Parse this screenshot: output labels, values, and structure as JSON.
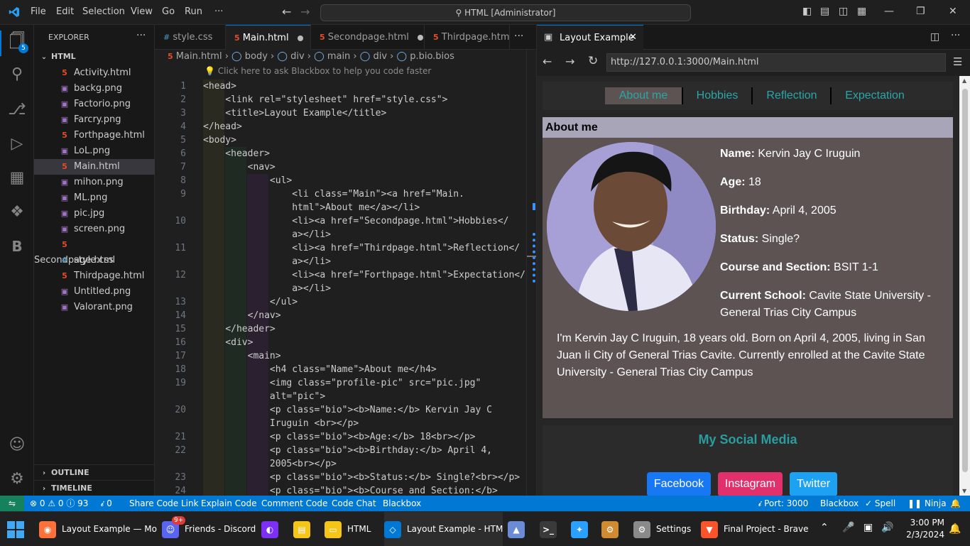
{
  "titlebar": {
    "menus": [
      "File",
      "Edit",
      "Selection",
      "View",
      "Go",
      "Run",
      "···"
    ],
    "command_center": "HTML [Administrator]"
  },
  "activity": {
    "explorer_badge": "5"
  },
  "explorer": {
    "title": "EXPLORER",
    "folder": "HTML",
    "files": [
      {
        "name": "Activity.html",
        "type": "html"
      },
      {
        "name": "backg.png",
        "type": "png"
      },
      {
        "name": "Factorio.png",
        "type": "png"
      },
      {
        "name": "Farcry.png",
        "type": "png"
      },
      {
        "name": "Forthpage.html",
        "type": "html"
      },
      {
        "name": "LoL.png",
        "type": "png"
      },
      {
        "name": "Main.html",
        "type": "html",
        "selected": true
      },
      {
        "name": "mihon.png",
        "type": "png"
      },
      {
        "name": "ML.png",
        "type": "png"
      },
      {
        "name": "pic.jpg",
        "type": "png"
      },
      {
        "name": "screen.png",
        "type": "png"
      },
      {
        "name": "Secondpage.html",
        "type": "html"
      },
      {
        "name": "style.css",
        "type": "css"
      },
      {
        "name": "Thirdpage.html",
        "type": "html"
      },
      {
        "name": "Untitled.png",
        "type": "png"
      },
      {
        "name": "Valorant.png",
        "type": "png"
      }
    ],
    "outline": "OUTLINE",
    "timeline": "TIMELINE"
  },
  "tabs": [
    "style.css",
    "Main.html",
    "Secondpage.html",
    "Thirdpage.htm"
  ],
  "breadcrumb": [
    "Main.html",
    "body",
    "div",
    "main",
    "div",
    "p.bio.bios"
  ],
  "blackbox_hint": "Click here to ask Blackbox to help you code faster",
  "code_lines": [
    {
      "n": "1",
      "t": "<head>"
    },
    {
      "n": "2",
      "t": "    <link rel=\"stylesheet\" href=\"style.css\">"
    },
    {
      "n": "3",
      "t": "    <title>Layout Example</title>"
    },
    {
      "n": "4",
      "t": "</head>"
    },
    {
      "n": "5",
      "t": "<body>"
    },
    {
      "n": "6",
      "t": "    <header>"
    },
    {
      "n": "7",
      "t": "        <nav>"
    },
    {
      "n": "8",
      "t": "            <ul>"
    },
    {
      "n": "9",
      "t": "                <li class=\"Main\"><a href=\"Main."
    },
    {
      "n": "",
      "t": "                html\">About me</a></li>"
    },
    {
      "n": "10",
      "t": "                <li><a href=\"Secondpage.html\">Hobbies</"
    },
    {
      "n": "",
      "t": "                a></li>"
    },
    {
      "n": "11",
      "t": "                <li><a href=\"Thirdpage.html\">Reflection</"
    },
    {
      "n": "",
      "t": "                a></li>"
    },
    {
      "n": "12",
      "t": "                <li><a href=\"Forthpage.html\">Expectation</"
    },
    {
      "n": "",
      "t": "                a></li>"
    },
    {
      "n": "13",
      "t": "            </ul>"
    },
    {
      "n": "14",
      "t": "        </nav>"
    },
    {
      "n": "15",
      "t": "    </header>"
    },
    {
      "n": "16",
      "t": "    <div>"
    },
    {
      "n": "17",
      "t": "        <main>"
    },
    {
      "n": "18",
      "t": "            <h4 class=\"Name\">About me</h4>"
    },
    {
      "n": "19",
      "t": "            <img class=\"profile-pic\" src=\"pic.jpg\""
    },
    {
      "n": "",
      "t": "            alt=\"pic\">"
    },
    {
      "n": "20",
      "t": "            <p class=\"bio\"><b>Name:</b> Kervin Jay C"
    },
    {
      "n": "",
      "t": "            Iruguin <br></p>"
    },
    {
      "n": "21",
      "t": "            <p class=\"bio\"><b>Age:</b> 18<br></p>"
    },
    {
      "n": "22",
      "t": "            <p class=\"bio\"><b>Birthday:</b> April 4,"
    },
    {
      "n": "",
      "t": "            2005<br></p>"
    },
    {
      "n": "23",
      "t": "            <p class=\"bio\"><b>Status:</b> Single?<br></p>"
    },
    {
      "n": "24",
      "t": "            <p class=\"bio\"><b>Course and Section:</b>"
    }
  ],
  "preview": {
    "tab_title": "Layout Example",
    "url": "http://127.0.0.1:3000/Main.html",
    "nav": [
      "About me",
      "Hobbies",
      "Reflection",
      "Expectation"
    ],
    "section_title": "About me",
    "info": [
      {
        "label": "Name:",
        "value": " Kervin Jay C Iruguin"
      },
      {
        "label": "Age:",
        "value": " 18"
      },
      {
        "label": "Birthday:",
        "value": " April 4, 2005"
      },
      {
        "label": "Status:",
        "value": " Single?"
      },
      {
        "label": "Course and Section:",
        "value": " BSIT 1-1"
      },
      {
        "label": "Current School:",
        "value": " Cavite State University - General Trias City Campus"
      }
    ],
    "bio": "I'm Kervin Jay C Iruguin, 18 years old. Born on April 4, 2005, living in San Juan Ii City of General Trias Cavite. Currently enrolled at the Cavite State University - General Trias City Campus",
    "social_title": "My Social Media",
    "social_buttons": [
      {
        "label": "Facebook",
        "color": "#1877f2"
      },
      {
        "label": "Instagram",
        "color": "#e1306c"
      },
      {
        "label": "Twitter",
        "color": "#1da1f2"
      }
    ]
  },
  "statusbar": {
    "problems": "⊗ 0 ⚠ 0 ⓘ 93",
    "ports_left": "0",
    "items": [
      "Share Code Link",
      "Explain Code",
      "Comment Code",
      "Code Chat",
      "Blackbox"
    ],
    "port": "Port: 3000",
    "right_items": [
      "Blackbox",
      "✓ Spell",
      "Ninja"
    ]
  },
  "taskbar": {
    "apps": [
      {
        "label": "Layout Example — Mo",
        "icon": "firefox-icon",
        "color": "#ff7139"
      },
      {
        "label": "Friends - Discord",
        "icon": "discord-icon",
        "color": "#5865f2",
        "badge": "9+"
      },
      {
        "label": "",
        "icon": "mask-icon",
        "color": "#7b2ff7"
      },
      {
        "label": "",
        "icon": "files-icon",
        "color": "#f5c518"
      },
      {
        "label": "HTML",
        "icon": "folder-icon",
        "color": "#f5c518"
      },
      {
        "label": "Layout Example - HTM",
        "icon": "vscode-icon",
        "color": "#0078d4"
      },
      {
        "label": "",
        "icon": "monitor-icon",
        "color": "#6a8bd6"
      },
      {
        "label": "",
        "icon": "terminal-icon",
        "color": "#3a3a3a"
      },
      {
        "label": "",
        "icon": "copilot-icon",
        "color": "#2ba0ff"
      },
      {
        "label": "",
        "icon": "gear-app-icon",
        "color": "#d08a30"
      },
      {
        "label": "Settings",
        "icon": "settings-icon",
        "color": "#8a8a8a"
      },
      {
        "label": "Final Project - Brave",
        "icon": "brave-icon",
        "color": "#fb542b"
      }
    ],
    "time": "3:00 PM",
    "date": "2/3/2024"
  }
}
